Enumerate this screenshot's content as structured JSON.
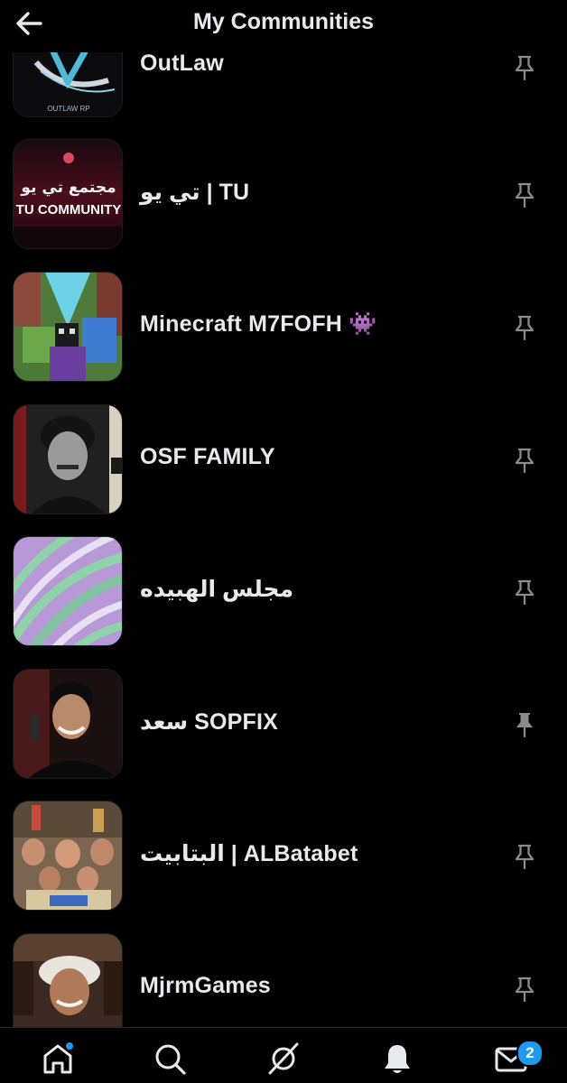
{
  "header": {
    "title": "My Communities",
    "back_icon": "arrow-left-icon"
  },
  "communities": [
    {
      "name": "OutLaw",
      "thumb_text": "OUTLAW RP",
      "pinned": false
    },
    {
      "name": "تي يو | TU",
      "thumb_text_top": "مجتمع تي يو",
      "thumb_text_bottom": "TU COMMUNITY",
      "pinned": false
    },
    {
      "name": "Minecraft M7FOFH 👾",
      "pinned": false
    },
    {
      "name": "OSF FAMILY",
      "pinned": false
    },
    {
      "name": "مجلس الهبيده",
      "pinned": false
    },
    {
      "name": "سعد SOPFIX",
      "pinned": true
    },
    {
      "name": "البتابيت | ALBatabet",
      "pinned": false
    },
    {
      "name": "MjrmGames",
      "pinned": false
    }
  ],
  "tabbar": {
    "items": [
      {
        "icon": "home-icon",
        "active": true
      },
      {
        "icon": "search-icon",
        "active": false
      },
      {
        "icon": "grok-icon",
        "active": false
      },
      {
        "icon": "bell-icon",
        "active": false
      },
      {
        "icon": "mail-icon",
        "active": false
      }
    ],
    "messages_badge": "2"
  },
  "colors": {
    "background": "#000000",
    "text": "#e7e9ea",
    "icon": "#8b8b8b",
    "accent": "#1d9bf0"
  }
}
